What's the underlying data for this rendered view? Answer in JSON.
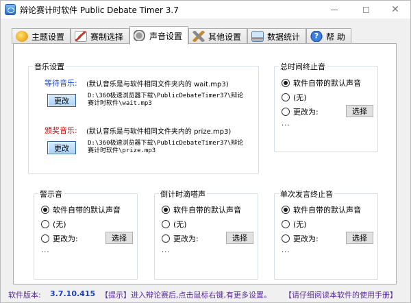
{
  "window": {
    "title": "辩论赛计时软件 Public Debate Timer 3.7"
  },
  "tabs": [
    {
      "label": "主题设置",
      "icon": "theme-icon"
    },
    {
      "label": "赛制选择",
      "icon": "pen-icon"
    },
    {
      "label": "声音设置",
      "icon": "speaker-icon"
    },
    {
      "label": "其他设置",
      "icon": "tools-icon"
    },
    {
      "label": "数据统计",
      "icon": "computer-icon"
    },
    {
      "label": "帮 助",
      "icon": "help-icon"
    }
  ],
  "active_tab": "声音设置",
  "music": {
    "title": "音乐设置",
    "wait_label": "等待音乐:",
    "wait_note": "(默认音乐是与软件相同文件夹内的 wait.mp3)",
    "wait_path_line1": "D:\\360极速浏览器下载\\PublicDebateTimer37\\辩论",
    "wait_path_line2": "赛计时软件\\wait.mp3",
    "prize_label": "颁奖音乐:",
    "prize_note": "(默认音乐是与软件相同文件夹内的 prize.mp3)",
    "prize_path_line1": "D:\\360极速浏览器下载\\PublicDebateTimer37\\辩论",
    "prize_path_line2": "赛计时软件\\prize.mp3",
    "change_label": "更改"
  },
  "groups": {
    "total_end": {
      "title": "总时间终止音"
    },
    "warning": {
      "title": "警示音"
    },
    "countdown": {
      "title": "倒计时滴嗒声"
    },
    "single_end": {
      "title": "单次发言终止音"
    }
  },
  "sound_options": {
    "default": "软件自带的默认声音",
    "none": "(无)",
    "change_to": "更改为:",
    "select": "选择",
    "dots": "..."
  },
  "status": {
    "version_label": "软件版本:",
    "version": "3.7.10.415",
    "tip": "【提示】进入辩论赛后,点击鼠标右键,有更多设置。",
    "manual": "【请仔细阅读本软件的使用手册】"
  },
  "colors": {
    "wait_label": "#1e4fd6",
    "prize_label": "#d40000",
    "version": "#1a3fbf",
    "status_text": "#5a2ca0"
  }
}
